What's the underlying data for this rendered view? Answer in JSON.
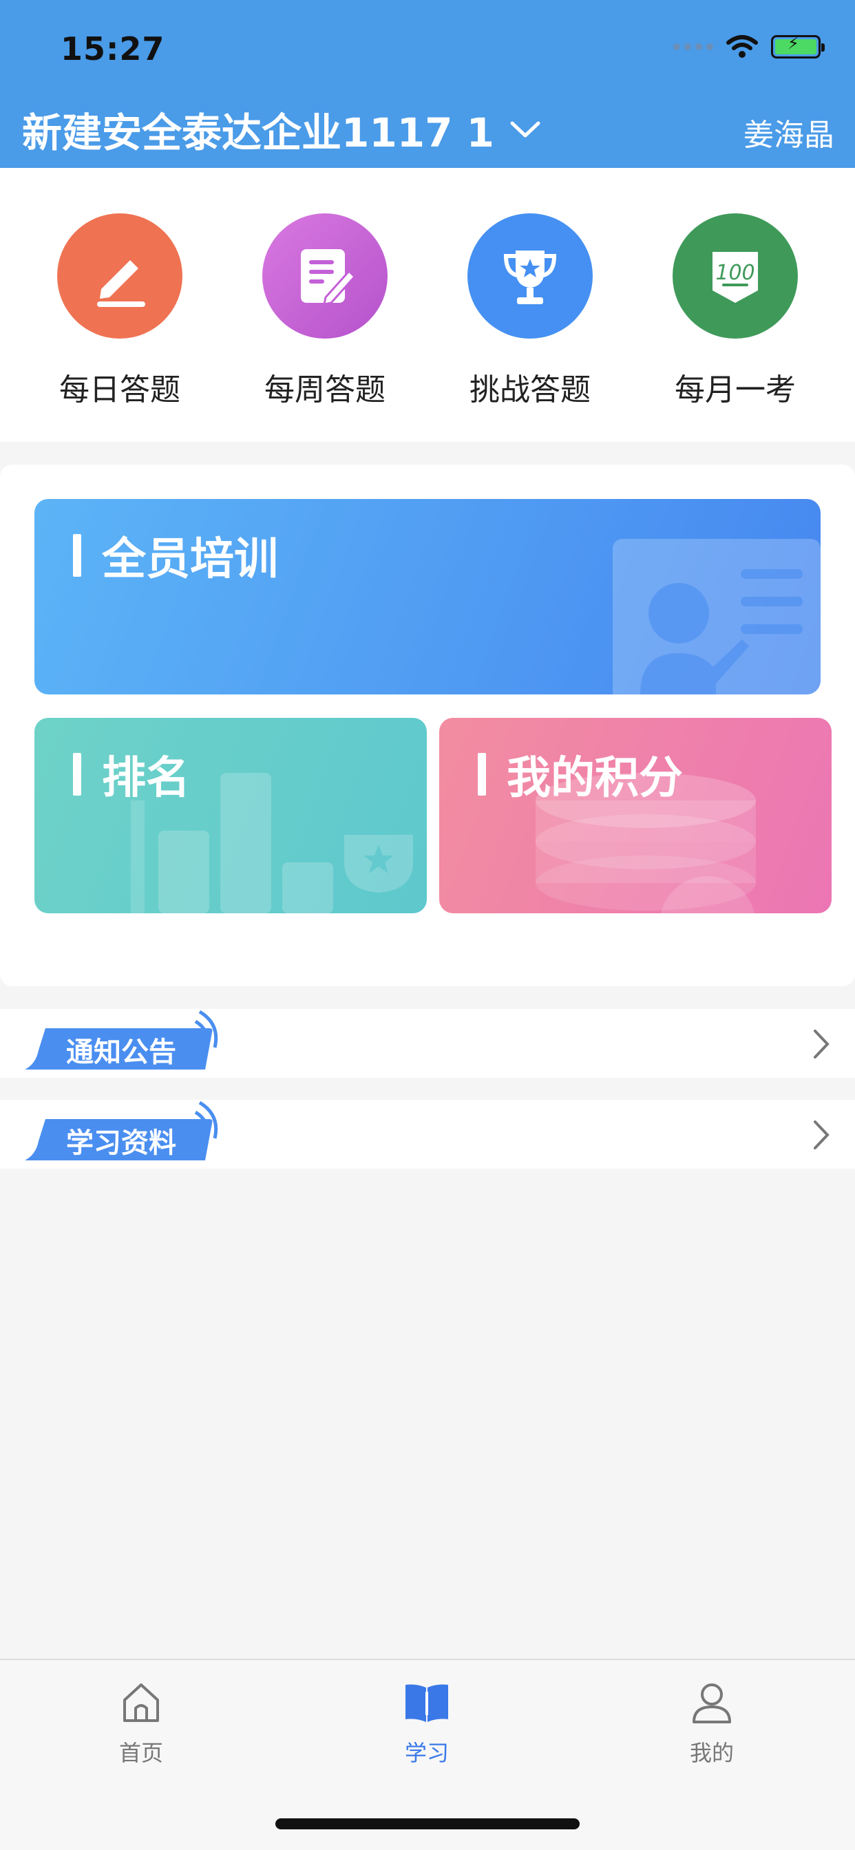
{
  "status_bar": {
    "time": "15:27"
  },
  "header": {
    "company": "新建安全泰达企业1117 1",
    "user": "姜海晶"
  },
  "quick_actions": [
    {
      "label": "每日答题",
      "icon": "pencil-icon",
      "color": "#ef6f4f"
    },
    {
      "label": "每周答题",
      "icon": "document-edit-icon",
      "color": "#c566d8"
    },
    {
      "label": "挑战答题",
      "icon": "trophy-icon",
      "color": "#3f8cf0"
    },
    {
      "label": "每月一考",
      "icon": "score-100-icon",
      "color": "#3f9a5a"
    }
  ],
  "cards": {
    "training": {
      "title": "全员培训",
      "colors": [
        "#5bb3f5",
        "#4a8af0"
      ]
    },
    "ranking": {
      "title": "排名",
      "colors": [
        "#6fd3c8",
        "#5ec9cd"
      ]
    },
    "points": {
      "title": "我的积分",
      "colors": [
        "#f08aa2",
        "#ee77b4"
      ]
    }
  },
  "rows": [
    {
      "label": "通知公告"
    },
    {
      "label": "学习资料"
    }
  ],
  "tabbar": [
    {
      "label": "首页",
      "icon": "home-icon",
      "active": false
    },
    {
      "label": "学习",
      "icon": "book-icon",
      "active": true
    },
    {
      "label": "我的",
      "icon": "profile-icon",
      "active": false
    }
  ]
}
